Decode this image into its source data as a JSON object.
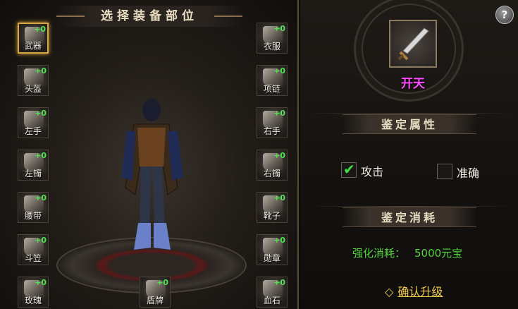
{
  "left_panel": {
    "title": "选择装备部位",
    "slots": [
      {
        "name": "weapon",
        "label": "武器",
        "bonus": "+0",
        "selected": true
      },
      {
        "name": "helmet",
        "label": "头盔",
        "bonus": "+0",
        "selected": false
      },
      {
        "name": "left-hand",
        "label": "左手",
        "bonus": "+0",
        "selected": false
      },
      {
        "name": "left-bracelet",
        "label": "左镯",
        "bonus": "+0",
        "selected": false
      },
      {
        "name": "belt",
        "label": "腰带",
        "bonus": "+0",
        "selected": false
      },
      {
        "name": "hat",
        "label": "斗笠",
        "bonus": "+0",
        "selected": false
      },
      {
        "name": "rose",
        "label": "玫瑰",
        "bonus": "+0",
        "selected": false
      },
      {
        "name": "shield",
        "label": "盾牌",
        "bonus": "+0",
        "selected": false
      },
      {
        "name": "armor",
        "label": "衣服",
        "bonus": "+0",
        "selected": false
      },
      {
        "name": "necklace",
        "label": "项链",
        "bonus": "+0",
        "selected": false
      },
      {
        "name": "right-hand",
        "label": "右手",
        "bonus": "+0",
        "selected": false
      },
      {
        "name": "right-bracelet",
        "label": "右镯",
        "bonus": "+0",
        "selected": false
      },
      {
        "name": "boots",
        "label": "靴子",
        "bonus": "+0",
        "selected": false
      },
      {
        "name": "medal",
        "label": "勋章",
        "bonus": "+0",
        "selected": false
      },
      {
        "name": "blood-stone",
        "label": "血石",
        "bonus": "+0",
        "selected": false
      }
    ]
  },
  "right_panel": {
    "help": "?",
    "weapon_name": "开天",
    "identify_title": "鉴定属性",
    "options": [
      {
        "label": "攻击",
        "checked": true
      },
      {
        "label": "准确",
        "checked": false
      }
    ],
    "cost_title": "鉴定消耗",
    "cost_label": "强化消耗：",
    "cost_value": "5000元宝",
    "confirm_label": "确认升级"
  },
  "colors": {
    "accent_gold": "#d9a640",
    "bonus_green": "#4fe34f",
    "weapon_name_magenta": "#ff4cff",
    "cost_green": "#55d43e",
    "confirm_yellow": "#f0c850"
  }
}
